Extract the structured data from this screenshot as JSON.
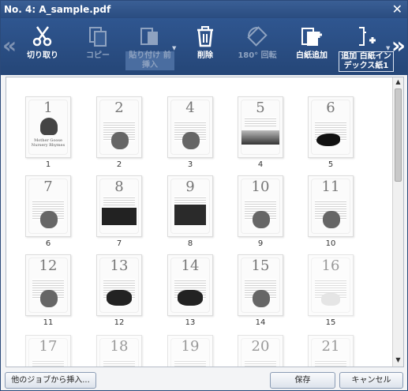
{
  "window": {
    "title": "No. 4: A_sample.pdf"
  },
  "toolbar": {
    "cut": "切り取り",
    "copy": "コピー",
    "paste_before": "貼り付け 前挿入",
    "delete": "削除",
    "rotate": "180° 回転",
    "add_blank": "白紙追加",
    "add_index_blank": "追加 白紙インデックス紙1"
  },
  "pages": [
    {
      "num": "1",
      "label": "1"
    },
    {
      "num": "2",
      "label": "2"
    },
    {
      "num": "4",
      "label": "3"
    },
    {
      "num": "5",
      "label": "4"
    },
    {
      "num": "6",
      "label": "5"
    },
    {
      "num": "7",
      "label": "6"
    },
    {
      "num": "8",
      "label": "7"
    },
    {
      "num": "9",
      "label": "8"
    },
    {
      "num": "10",
      "label": "9"
    },
    {
      "num": "11",
      "label": "10"
    },
    {
      "num": "12",
      "label": "11"
    },
    {
      "num": "13",
      "label": "12"
    },
    {
      "num": "14",
      "label": "13"
    },
    {
      "num": "15",
      "label": "14"
    },
    {
      "num": "16",
      "label": "15"
    },
    {
      "num": "17",
      "label": ""
    },
    {
      "num": "18",
      "label": ""
    },
    {
      "num": "19",
      "label": ""
    },
    {
      "num": "20",
      "label": ""
    },
    {
      "num": "21",
      "label": ""
    }
  ],
  "page1_cover": "Mother Goose Nursery Rhymes",
  "buttons": {
    "insert_from_job": "他のジョブから挿入...",
    "save": "保存",
    "cancel": "キャンセル"
  }
}
